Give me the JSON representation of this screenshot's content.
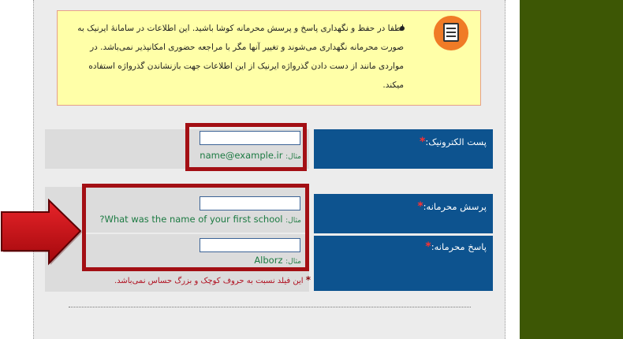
{
  "notice": {
    "icon": "document-icon",
    "text": "لطفا در حفظ و نگهداری پاسخ و پرسش محرمانه کوشا باشید. این اطلاعات در سامانهٔ ایرنیک به صورت محرمانه نگهداری می‌شوند و تغییر آنها مگر با مراجعه حضوری امکانپذیر نمی‌باشد. در مواردی مانند از دست دادن گذرواژه ایرنیک از این اطلاعات جهت بازنشاندن گذرواژه استفاده میکند."
  },
  "email": {
    "label": "پست الکترونیک:",
    "required_mark": "*",
    "value": "",
    "example_label": "مثال:",
    "example_value": "name@example.ir"
  },
  "secret_question": {
    "label": "پرسش محرمانه:",
    "required_mark": "*",
    "value": "",
    "example_label": "مثال:",
    "example_value": "What was the name of your first school?"
  },
  "secret_answer": {
    "label": "پاسخ محرمانه:",
    "required_mark": "*",
    "value": "",
    "example_label": "مثال:",
    "example_value": "Alborz"
  },
  "case_hint": {
    "star": "*",
    "text": "این فیلد نسبت به حروف کوچک و بزرگ حساس نمی‌باشد."
  },
  "colors": {
    "label_bg": "#0d538f",
    "highlight_border": "#a30f14",
    "notice_bg": "#ffffa8",
    "right_band": "#3d5705",
    "example_text": "#1c7a42"
  }
}
